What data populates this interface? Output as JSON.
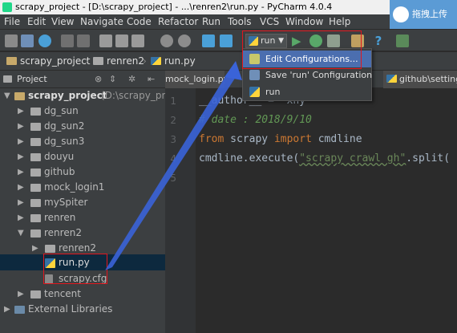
{
  "window": {
    "title": "scrapy_project - [D:\\scrapy_project] - ...\\renren2\\run.py - PyCharm 4.0.4",
    "overlay_button": "拖拽上传"
  },
  "menu": [
    "File",
    "Edit",
    "View",
    "Navigate",
    "Code",
    "Refactor",
    "Run",
    "Tools",
    "VCS",
    "Window",
    "Help"
  ],
  "toolbar": {
    "run_config": "run"
  },
  "breadcrumb": [
    "scrapy_project",
    "renren2",
    "run.py"
  ],
  "project_panel": {
    "label": "Project",
    "editor_tabs": [
      "mock_login.py",
      "github\\setting"
    ]
  },
  "tree": [
    {
      "label": "scrapy_project",
      "path": "(D:\\scrapy_proje"
    },
    {
      "label": "dg_sun"
    },
    {
      "label": "dg_sun2"
    },
    {
      "label": "dg_sun3"
    },
    {
      "label": "douyu"
    },
    {
      "label": "github"
    },
    {
      "label": "mock_login1"
    },
    {
      "label": "mySpiter"
    },
    {
      "label": "renren"
    },
    {
      "label": "renren2"
    },
    {
      "label": "renren2"
    },
    {
      "label": "run.py"
    },
    {
      "label": "scrapy.cfg"
    },
    {
      "label": "tencent"
    },
    {
      "label": "External Libraries"
    }
  ],
  "line_numbers": [
    "1",
    "2",
    "3",
    "4",
    "5"
  ],
  "code": {
    "line1": "__author__ = 'xhy'",
    "line2": "# date : 2018/9/10",
    "line3_kw1": "from",
    "line3_mid": " scrapy ",
    "line3_kw2": "import",
    "line3_end": " cmdline",
    "line4_pre": "cmdline.execute(",
    "line4_str": "\"scrapy crawl gh\"",
    "line4_post": ".split("
  },
  "dropdown": {
    "items": [
      "Edit Configurations...",
      "Save 'run' Configuration",
      "run"
    ]
  },
  "colors": {
    "highlight_red": "#e2161d",
    "annotation_arrow": "#3a63d8",
    "selection_blue": "#4b6eaf"
  }
}
